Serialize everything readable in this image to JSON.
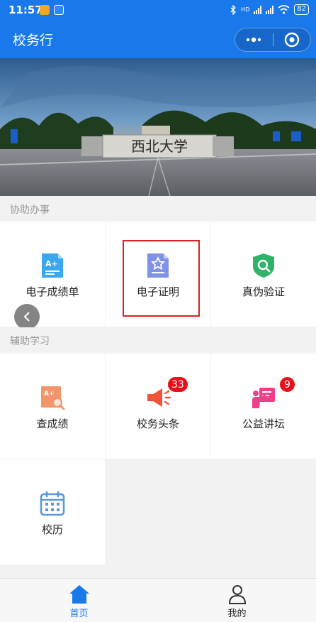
{
  "status_bar": {
    "time": "11:57",
    "network": "HD",
    "battery": "82"
  },
  "app_bar": {
    "title": "校务行"
  },
  "banner": {
    "gate_text": "西北大学"
  },
  "sections": [
    {
      "header": "协助办事",
      "items": [
        {
          "label": "电子成绩单",
          "icon": "transcript-icon"
        },
        {
          "label": "电子证明",
          "icon": "certificate-icon"
        },
        {
          "label": "真伪验证",
          "icon": "shield-search-icon"
        }
      ]
    },
    {
      "header": "辅助学习",
      "items": [
        {
          "label": "查成绩",
          "icon": "grade-search-icon"
        },
        {
          "label": "校务头条",
          "icon": "megaphone-icon",
          "badge": "33"
        },
        {
          "label": "公益讲坛",
          "icon": "lecture-icon",
          "badge": "9"
        },
        {
          "label": "校历",
          "icon": "calendar-icon"
        }
      ]
    }
  ],
  "tab_bar": [
    {
      "label": "首页",
      "icon": "home-icon",
      "active": true
    },
    {
      "label": "我的",
      "icon": "person-icon",
      "active": false
    }
  ],
  "colors": {
    "primary": "#1a79ea",
    "badge": "#e8101a",
    "highlight": "#e01f1f"
  }
}
